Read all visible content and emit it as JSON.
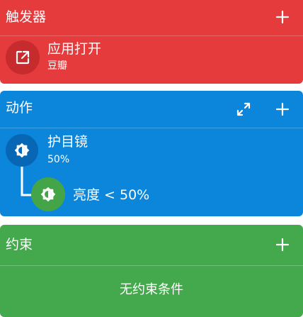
{
  "colors": {
    "trigger_card": "#E53B3C",
    "action_card": "#0B86DB",
    "constraint_card": "#44A94C",
    "trigger_icon_bg": "#C62B2D",
    "action_icon_bg": "#0867B4",
    "condition_icon_bg": "#43A547"
  },
  "triggers": {
    "title": "触发器",
    "add_icon": "plus-icon",
    "items": [
      {
        "title": "应用打开",
        "subtitle": "豆瓣",
        "icon": "open-in-new-icon"
      }
    ]
  },
  "actions": {
    "title": "动作",
    "expand_icon": "expand-icon",
    "add_icon": "plus-icon",
    "items": [
      {
        "title": "护目镜",
        "subtitle": "50%",
        "icon": "brightness-icon",
        "conditions": [
          {
            "label": "亮度 < 50%",
            "icon": "brightness-icon"
          }
        ]
      }
    ]
  },
  "constraints": {
    "title": "约束",
    "add_icon": "plus-icon",
    "empty_text": "无约束条件"
  }
}
